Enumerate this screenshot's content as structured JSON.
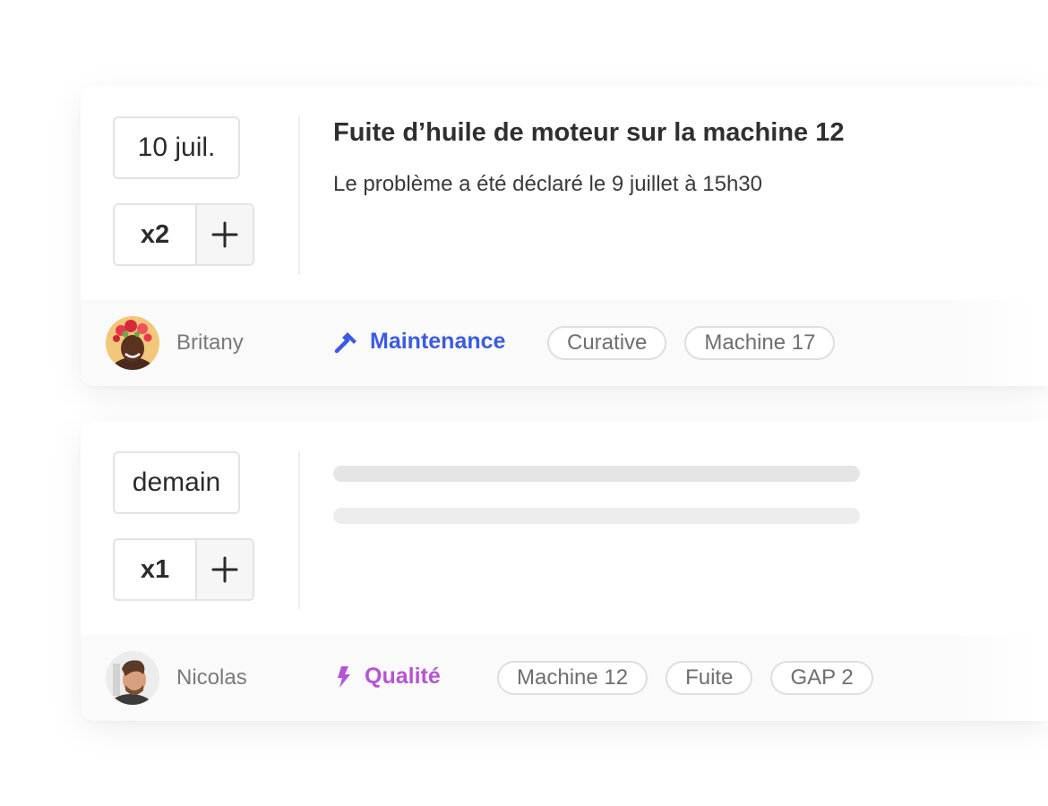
{
  "cards": [
    {
      "date": "10 juil.",
      "count": "x2",
      "title": "Fuite d’huile de moteur sur la machine 12",
      "description": "Le problème a été déclaré le 9 juillet à 15h30",
      "user": {
        "name": "Britany",
        "avatar_icon": "avatar-britany"
      },
      "category": {
        "label": "Maintenance",
        "icon": "hammer-icon",
        "color": "#3b5be0"
      },
      "tags": [
        "Curative",
        "Machine 17"
      ]
    },
    {
      "date": "demain",
      "count": "x1",
      "user": {
        "name": "Nicolas",
        "avatar_icon": "avatar-nicolas"
      },
      "category": {
        "label": "Qualité",
        "icon": "lightning-icon",
        "color": "#b455d4"
      },
      "tags": [
        "Machine 12",
        "Fuite",
        "GAP 2"
      ]
    }
  ]
}
